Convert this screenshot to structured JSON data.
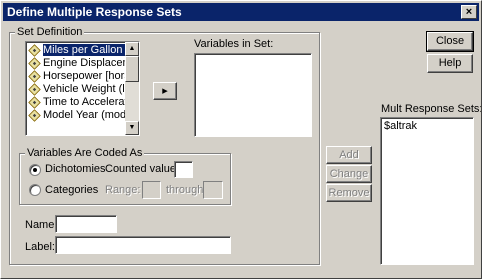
{
  "window": {
    "title": "Define Multiple Response Sets",
    "close_glyph": "×"
  },
  "set_definition": {
    "label": "Set Definition",
    "variables": [
      "Miles per Gallon [m",
      "Engine Displaceme",
      "Horsepower [horse]",
      "Vehicle Weight (lbs",
      "Time to Accelerate",
      "Model Year (modulo"
    ],
    "selected_index": 0,
    "move_button_glyph": "▸",
    "variables_in_set_label": "Variables in Set:",
    "variables_in_set": []
  },
  "coded_as": {
    "label": "Variables Are Coded As",
    "dichotomies_label": "Dichotomies",
    "counted_value_label": "Counted value:",
    "counted_value": "",
    "categories_label": "Categories",
    "range_label": "Range:",
    "range_from": "",
    "through_label": "through",
    "range_to": "",
    "selected": "dichotomies"
  },
  "name_label": "Name:",
  "name_value": "",
  "label_label": "Label:",
  "label_value": "",
  "buttons": {
    "close": "Close",
    "help": "Help",
    "add": "Add",
    "change": "Change",
    "remove": "Remove"
  },
  "mult_response_sets": {
    "label": "Mult Response Sets:",
    "items": [
      "$altrak"
    ]
  },
  "colors": {
    "titlebar": "#0a246a",
    "face": "#d4d0c8",
    "selection": "#0a246a"
  },
  "icons": {
    "variable": "scale-variable-icon",
    "scroll_up": "scroll-up-arrow-icon",
    "scroll_down": "scroll-down-arrow-icon"
  }
}
